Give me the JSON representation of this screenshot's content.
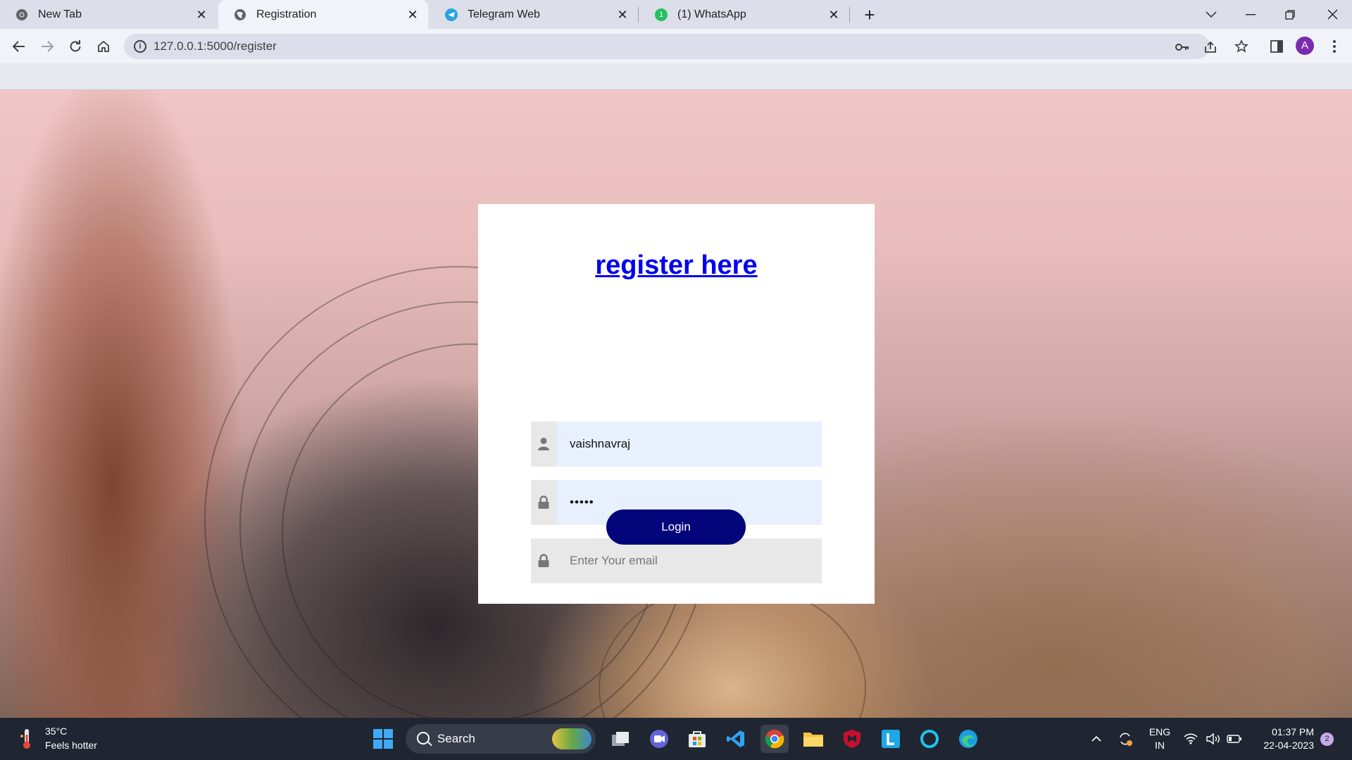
{
  "browser": {
    "tabs": [
      {
        "title": "New Tab",
        "icon": "chrome-icon",
        "active": false
      },
      {
        "title": "Registration",
        "icon": "globe-icon",
        "active": true
      },
      {
        "title": "Telegram Web",
        "icon": "telegram-icon",
        "active": false
      },
      {
        "title": "(1) WhatsApp",
        "icon": "whatsapp-icon",
        "active": false
      }
    ],
    "address": "127.0.0.1:5000/register",
    "profile_initial": "A",
    "accent": "#7b2bb0"
  },
  "form": {
    "title": "register here",
    "username_value": "vaishnavraj",
    "password_value": "•••••",
    "email_placeholder": "Enter Your email",
    "submit_label": "Login",
    "submit_color": "#03067b",
    "field_fill_color": "#e8f0fe"
  },
  "taskbar": {
    "weather_temp": "35°C",
    "weather_desc": "Feels hotter",
    "search_label": "Search",
    "lang_top": "ENG",
    "lang_bottom": "IN",
    "time": "01:37 PM",
    "date": "22-04-2023",
    "notification_count": "2"
  }
}
